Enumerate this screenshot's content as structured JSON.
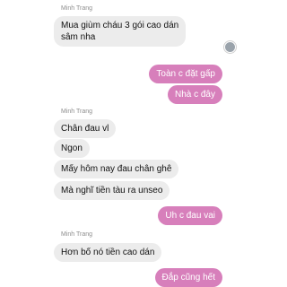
{
  "colors": {
    "incoming_bubble": "#ececec",
    "outgoing_bubble": "#d77fbb",
    "incoming_text": "#111111",
    "outgoing_text": "#ffffff",
    "sender_name": "#8e8e8e"
  },
  "messages": {
    "group1_sender": "Minh Trang",
    "m1_line1": "Mua giùm cháu 3 gói cao dán",
    "m1_line2": "sâm nha",
    "reply1": "Toàn  c đặt gấp",
    "reply2": "Nhà c đây",
    "group2_sender": "Minh Trang",
    "m2": "Chân đau vl",
    "m3": "Ngon",
    "m4": "Mấy hôm nay đau chân ghê",
    "m5": "Mà nghĩ tiền tàu ra unseo",
    "reply3": "Uh c đau vai",
    "group3_sender": "Minh Trang",
    "m6": "Hơn bố nó tiền cao dán",
    "reply4": "Đắp cũng hết"
  },
  "icons": {
    "seen_indicator": "seen-avatar-icon"
  }
}
